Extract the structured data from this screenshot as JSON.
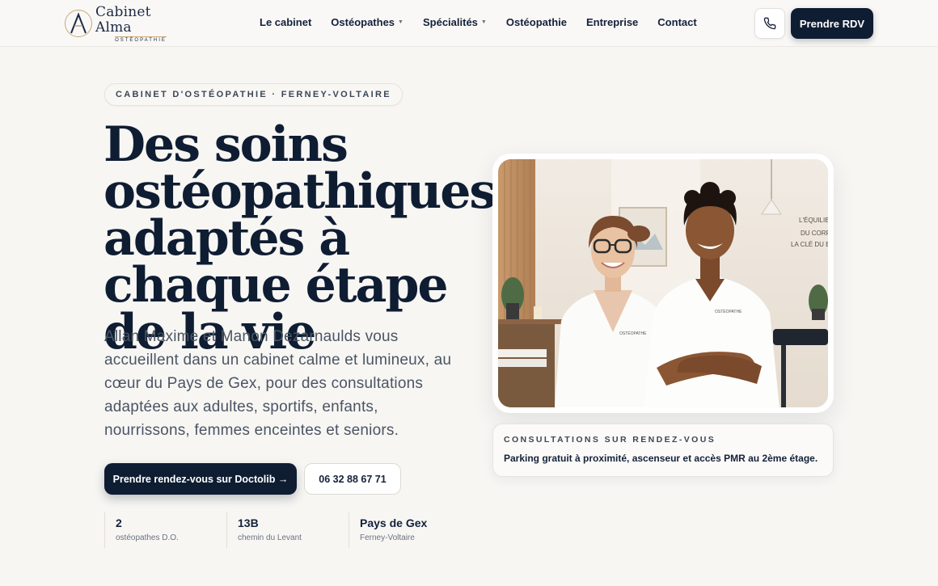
{
  "header": {
    "logo": {
      "name": "Cabinet Alma",
      "sub": "OSTÉOPATHIE"
    },
    "nav": [
      {
        "label": "Le cabinet",
        "dropdown": false
      },
      {
        "label": "Ostéopathes",
        "dropdown": true
      },
      {
        "label": "Spécialités",
        "dropdown": true
      },
      {
        "label": "Ostéopathie",
        "dropdown": false
      },
      {
        "label": "Entreprise",
        "dropdown": false
      },
      {
        "label": "Contact",
        "dropdown": false
      }
    ],
    "phone_icon": "phone-icon",
    "cta_label": "Prendre RDV"
  },
  "hero": {
    "badge": "CABINET D'OSTÉOPATHIE · FERNEY-VOLTAIRE",
    "title": "Des soins ostéopathiques adaptés à chaque étape de la vie",
    "lead": "Allan Maxime et Manon Dezarnaulds vous accueillent dans un cabinet calme et lumineux, au cœur du Pays de Gex, pour des consultations adaptées aux adultes, sportifs, enfants, nourrissons, femmes enceintes et seniors.",
    "cta_primary": "Prendre rendez-vous sur Doctolib →",
    "cta_secondary": "06 32 88 67 71",
    "stats": [
      {
        "value": "2",
        "label": "ostéopathes D.O."
      },
      {
        "value": "13B",
        "label": "chemin du Levant"
      },
      {
        "value": "Pays de Gex",
        "label": "Ferney-Voltaire"
      }
    ]
  },
  "photo": {
    "wall_text": [
      "L'ÉQUILIB",
      "DU CORP",
      "LA CLÉ DU B"
    ],
    "shirt_text": "OSTÉOPATHE"
  },
  "info_card": {
    "kicker": "CONSULTATIONS SUR RENDEZ-VOUS",
    "text": "Parking gratuit à proximité, ascenseur et accès PMR au 2ème étage."
  },
  "colors": {
    "navy": "#0f1d33",
    "gold": "#c9a67a",
    "background": "#f7f6f3"
  }
}
